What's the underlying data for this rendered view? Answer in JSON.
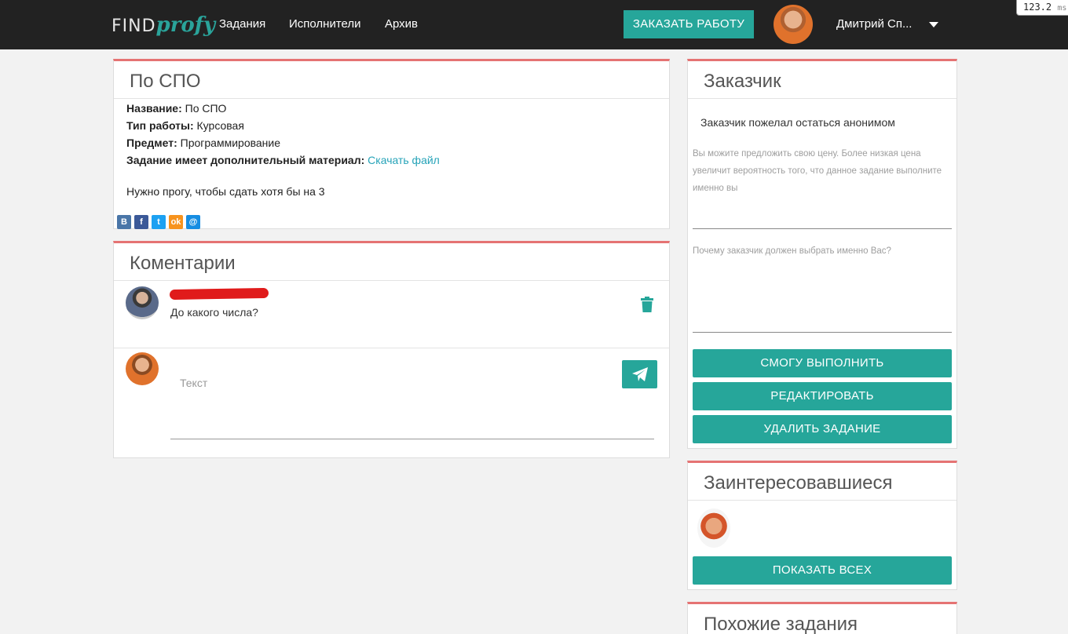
{
  "header": {
    "logo_part1": "FIND",
    "logo_part2": "profy",
    "nav": [
      "Задания",
      "Исполнители",
      "Архив"
    ],
    "order_button": "ЗАКАЗАТЬ РАБОТУ",
    "user_name": "Дмитрий Сп...",
    "timing_value": "123.2",
    "timing_unit": "ms"
  },
  "task": {
    "title": "По СПО",
    "name_label": "Название:",
    "name_value": "По СПО",
    "type_label": "Тип работы:",
    "type_value": "Курсовая",
    "subject_label": "Предмет:",
    "subject_value": "Программирование",
    "material_label": "Задание имеет дополнительный материал:",
    "material_link": "Скачать файл",
    "description": "Нужно прогу, чтобы сдать хотя бы на 3",
    "share_buttons": [
      "В",
      "f",
      "t",
      "ok",
      "@"
    ]
  },
  "comments": {
    "title": "Коментарии",
    "items": [
      {
        "text": "До какого числа?"
      }
    ],
    "input_placeholder": "Текст"
  },
  "customer": {
    "title": "Заказчик",
    "anonymous_text": "Заказчик пожелал остаться анонимом",
    "price_hint": "Вы можите предложить свою цену. Более низкая цена увеличит вероятность того, что данное задание выполните именно вы",
    "why_label": "Почему заказчик должен выбрать именно Вас?",
    "buttons": {
      "can_do": "СМОГУ ВЫПОЛНИТЬ",
      "edit": "РЕДАКТИРОВАТЬ",
      "delete": "УДАЛИТЬ ЗАДАНИЕ"
    }
  },
  "interested": {
    "title": "Заинтересовавшиеся",
    "show_all": "ПОКАЗАТЬ ВСЕХ"
  },
  "similar": {
    "title": "Похожие задания"
  },
  "colors": {
    "accent": "#26a69a",
    "card_top_border": "#e57373",
    "topbar": "#222222",
    "link": "#26a3b8"
  }
}
